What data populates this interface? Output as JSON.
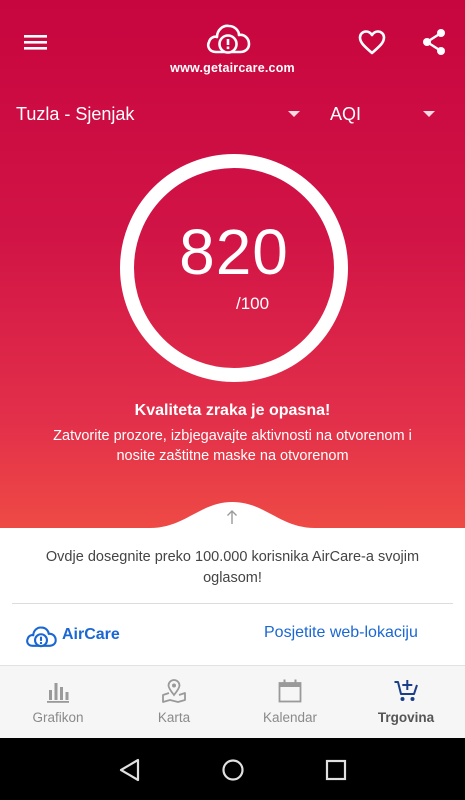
{
  "header": {
    "site_url": "www.getaircare.com",
    "logo_icon": "cloud-alert-icon",
    "menu_icon": "hamburger-menu-icon",
    "favorite_icon": "heart-icon",
    "share_icon": "share-icon"
  },
  "selectors": {
    "location": "Tuzla - Sjenjak",
    "metric": "AQI"
  },
  "gauge": {
    "value": "820",
    "max_label": "/100"
  },
  "status": {
    "title": "Kvaliteta zraka je opasna!",
    "description": "Zatvorite prozore, izbjegavajte aktivnosti na otvorenom i nosite zaštitne maske na otvorenom"
  },
  "ad": {
    "text": "Ovdje dosegnite preko 100.000 korisnika AirCare-a svojim oglasom!",
    "brand_name": "AirCare",
    "visit_link": "Posjetite web-lokaciju"
  },
  "bottom_nav": {
    "items": [
      {
        "label": "Grafikon",
        "icon": "bar-chart-icon",
        "active": false
      },
      {
        "label": "Karta",
        "icon": "map-pin-icon",
        "active": false
      },
      {
        "label": "Kalendar",
        "icon": "calendar-icon",
        "active": false
      },
      {
        "label": "Trgovina",
        "icon": "cart-plus-icon",
        "active": true
      }
    ]
  },
  "colors": {
    "hero_top": "#c7053f",
    "hero_bottom": "#ee4a45",
    "accent_link": "#1a67d2"
  }
}
